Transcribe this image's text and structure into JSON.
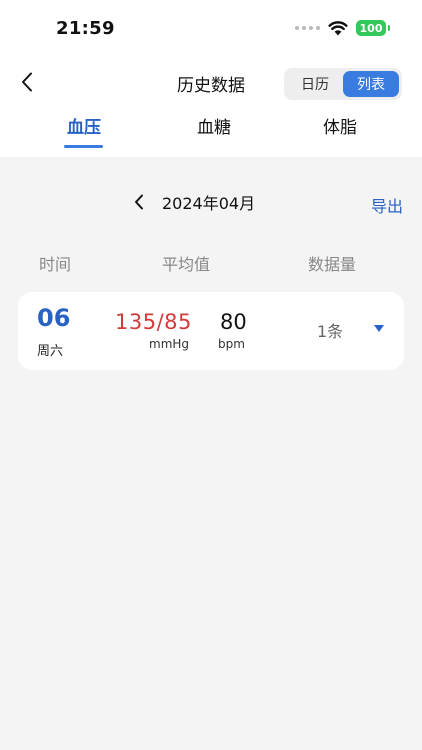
{
  "status_bar": {
    "time": "21:59",
    "battery": "100"
  },
  "nav": {
    "title": "历史数据",
    "view_toggle": {
      "calendar": "日历",
      "list": "列表",
      "selected": "list"
    }
  },
  "tabs": [
    {
      "label": "血压",
      "active": true
    },
    {
      "label": "血糖"
    },
    {
      "label": "体脂"
    }
  ],
  "month": {
    "label": "2024年04月",
    "export": "导出"
  },
  "columns": {
    "time": "时间",
    "average": "平均值",
    "count": "数据量"
  },
  "records": [
    {
      "day": "06",
      "weekday": "周六",
      "bp": "135/85",
      "bp_unit": "mmHg",
      "pulse": "80",
      "pulse_unit": "bpm",
      "count": "1条"
    }
  ],
  "colors": {
    "accent": "#3a7be0",
    "bp_value": "#d33a3a",
    "battery": "#34c759"
  },
  "icons": [
    "back-chevron-icon",
    "wifi-icon",
    "battery-icon",
    "month-prev-chevron-icon",
    "expand-triangle-icon"
  ]
}
